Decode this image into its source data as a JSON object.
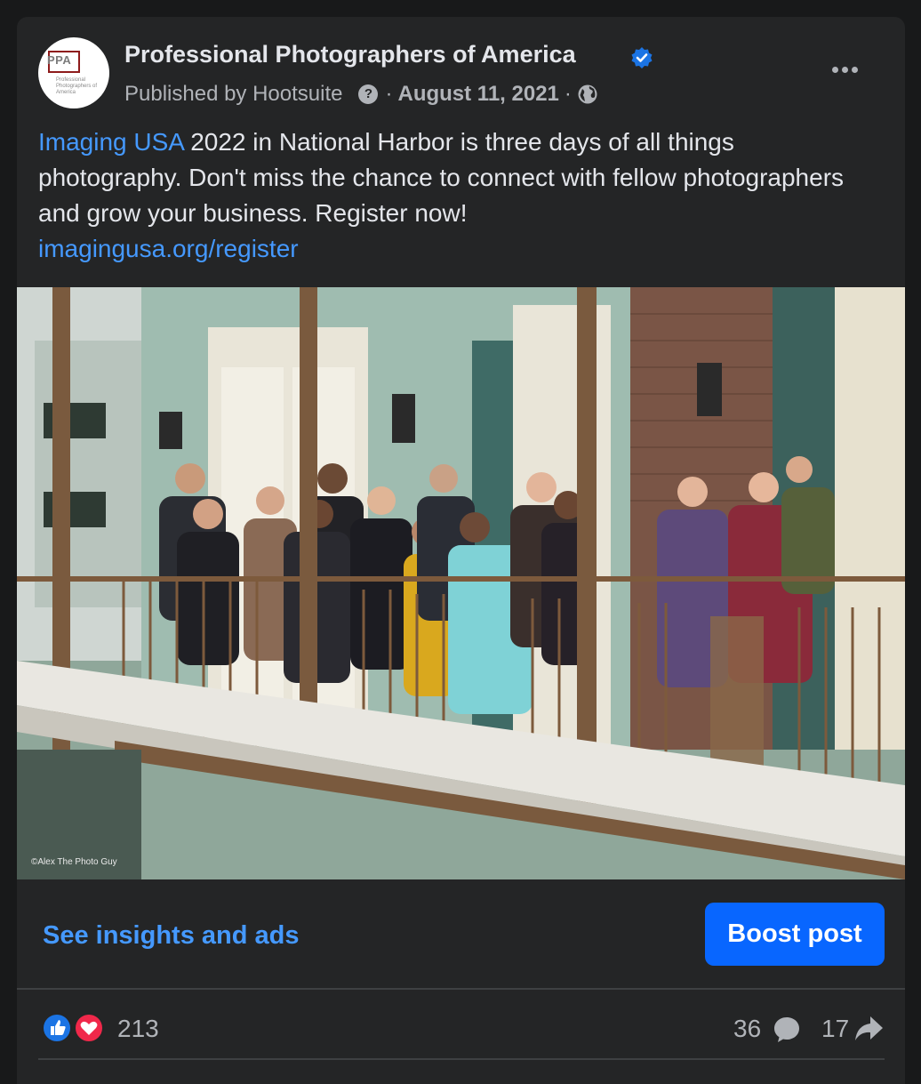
{
  "post": {
    "page_name": "Professional Photographers of America",
    "avatar_abbr": "PPA",
    "avatar_subtitle": "Professional Photographers of America",
    "published_by": "Published by Hootsuite",
    "date": "August 11, 2021",
    "separator": "·",
    "text_link_start": "Imaging USA",
    "text_body": " 2022 in National Harbor is three days of all things photography.  Don't miss the chance to connect with fellow photographers and grow your business. Register now!",
    "text_link_url": "imagingusa.org/register",
    "photo_watermark": "©Alex The Photo Guy"
  },
  "actions": {
    "insights_label": "See insights and ads",
    "boost_label": "Boost post"
  },
  "stats": {
    "reactions_count": "213",
    "comments_count": "36",
    "shares_count": "17"
  },
  "colors": {
    "background": "#18191a",
    "card": "#242526",
    "link": "#4599ff",
    "boost": "#0866ff",
    "like": "#1b74e4",
    "love": "#f0284a"
  },
  "icons": [
    "verified-badge-icon",
    "help-icon",
    "globe-icon",
    "more-options-icon",
    "like-reaction-icon",
    "love-reaction-icon",
    "comment-icon",
    "share-icon"
  ]
}
